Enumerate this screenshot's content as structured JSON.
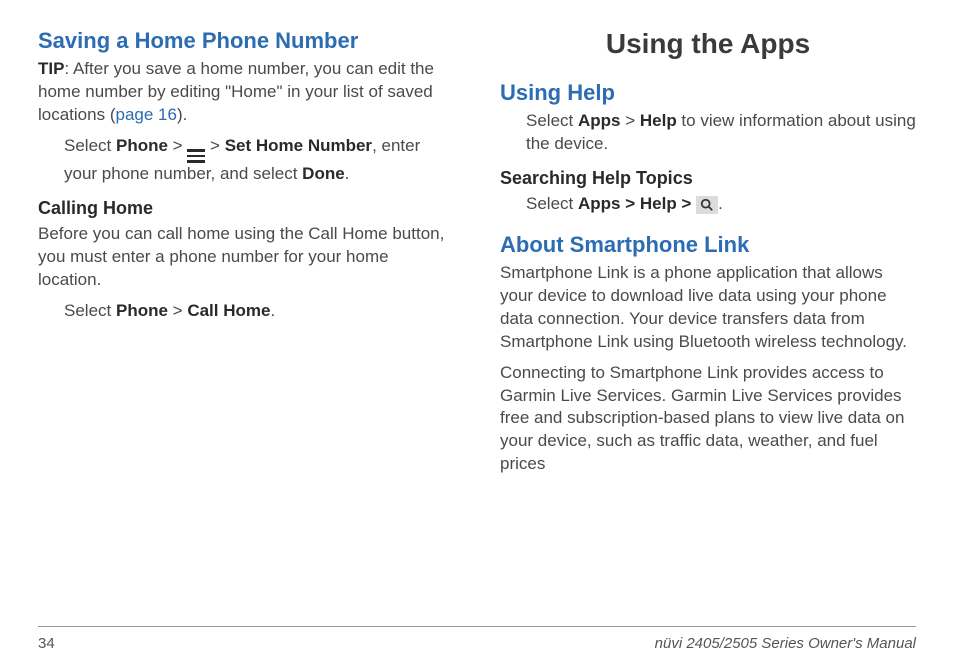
{
  "left": {
    "h_saving": "Saving a Home Phone Number",
    "tip_label": "TIP",
    "tip_body1": ": After you save a home number, you can edit the home number by editing \"Home\" in your list of saved locations (",
    "tip_link": "page 16",
    "tip_body2": ").",
    "step1_a": "Select ",
    "step1_phone": "Phone",
    "step1_b": " > ",
    "step1_c": " > ",
    "step1_set": "Set Home Number",
    "step1_d": ", enter your phone number, and select ",
    "step1_done": "Done",
    "step1_e": ".",
    "h_calling": "Calling Home",
    "calling_body": "Before you can call home using the Call Home button, you must enter a phone number for your home location.",
    "step2_a": "Select ",
    "step2_phone": "Phone",
    "step2_b": " > ",
    "step2_call": "Call Home",
    "step2_c": "."
  },
  "right": {
    "h_using_apps": "Using the Apps",
    "h_using_help": "Using Help",
    "help_a": "Select ",
    "help_apps": "Apps",
    "help_b": " > ",
    "help_help": "Help",
    "help_c": " to view information about using the device.",
    "h_searching": "Searching Help Topics",
    "search_a": "Select ",
    "search_path": "Apps > Help > ",
    "search_c": ".",
    "h_smartphone": "About Smartphone Link",
    "smartphone_p1": "Smartphone Link is a phone application that allows your device to download live data using your phone data connection. Your device transfers data from Smartphone Link using Bluetooth wireless technology.",
    "smartphone_p2": "Connecting to Smartphone Link provides access to Garmin Live Services. Garmin Live Services provides free and subscription-based plans to view live data on your device, such as traffic data, weather, and fuel prices"
  },
  "footer": {
    "page": "34",
    "manual_italic": "nüvi 2405/2505 Series Owner's Manual"
  }
}
